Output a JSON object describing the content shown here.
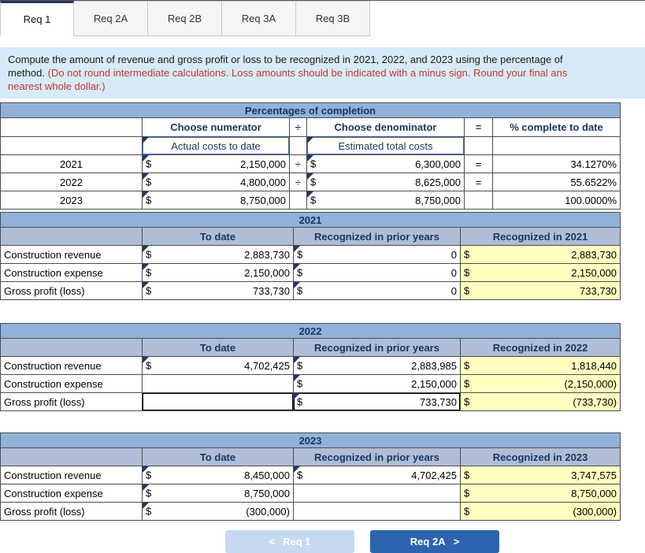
{
  "currency": "$",
  "colors": {
    "banner_blue": "#92b1d9",
    "subheader_blue": "#b0bdd7",
    "highlight_yellow": "#ffffc1",
    "instruction_bg": "#d7eaf7",
    "instruction_red": "#c0392b",
    "next_button_blue": "#2d64ad",
    "prev_button_blue": "#c7d9f1",
    "marker_navy": "#203864",
    "select_border_blue": "#4472c4"
  },
  "tabs": [
    {
      "label": "Req 1",
      "active": true
    },
    {
      "label": "Req 2A",
      "active": false
    },
    {
      "label": "Req 2B",
      "active": false
    },
    {
      "label": "Req 3A",
      "active": false
    },
    {
      "label": "Req 3B",
      "active": false
    }
  ],
  "instructions": {
    "line1_black": "Compute the amount of revenue and gross profit or loss to be recognized in 2021, 2022, and 2023 using the percentage of",
    "line2_black": "method.",
    "line2_red": "(Do not round intermediate calculations. Loss amounts should be indicated with a minus sign. Round your final ans",
    "line3_red": "nearest whole dollar.)"
  },
  "pct_table": {
    "title": "Percentages of completion",
    "headers": {
      "numerator": "Choose numerator",
      "divide": "÷",
      "denominator": "Choose denominator",
      "equals": "=",
      "pct": "% complete to date"
    },
    "selectors": {
      "numerator": "Actual costs to date",
      "denominator": "Estimated total costs"
    },
    "rows": [
      {
        "year": "2021",
        "numerator": "2,150,000",
        "divide": "÷",
        "denominator": "6,300,000",
        "equals": "=",
        "pct": "34.1270%"
      },
      {
        "year": "2022",
        "numerator": "4,800,000",
        "divide": "÷",
        "denominator": "8,625,000",
        "equals": "=",
        "pct": "55.6522%"
      },
      {
        "year": "2023",
        "numerator": "8,750,000",
        "divide": "",
        "denominator": "8,750,000",
        "equals": "",
        "pct": "100.0000%"
      }
    ]
  },
  "sections": [
    {
      "title": "2021",
      "headers": {
        "to_date": "To date",
        "prior": "Recognized in prior years",
        "recognized": "Recognized in 2021"
      },
      "rows": [
        {
          "label": "Construction revenue",
          "to_date": "2,883,730",
          "prior": "0",
          "recognized": "2,883,730"
        },
        {
          "label": "Construction expense",
          "to_date": "2,150,000",
          "prior": "0",
          "recognized": "2,150,000"
        },
        {
          "label": "Gross profit (loss)",
          "to_date": "733,730",
          "prior": "0",
          "recognized": "733,730"
        }
      ]
    },
    {
      "title": "2022",
      "headers": {
        "to_date": "To date",
        "prior": "Recognized in prior years",
        "recognized": "Recognized in 2022"
      },
      "rows": [
        {
          "label": "Construction revenue",
          "to_date": "4,702,425",
          "prior": "2,883,985",
          "recognized": "1,818,440"
        },
        {
          "label": "Construction expense",
          "to_date": "",
          "prior": "2,150,000",
          "recognized": "(2,150,000)"
        },
        {
          "label": "Gross profit (loss)",
          "to_date": "",
          "prior": "733,730",
          "recognized": "(733,730)"
        }
      ]
    },
    {
      "title": "2023",
      "headers": {
        "to_date": "To date",
        "prior": "Recognized in prior years",
        "recognized": "Recognized in 2023"
      },
      "rows": [
        {
          "label": "Construction revenue",
          "to_date": "8,450,000",
          "prior": "4,702,425",
          "recognized": "3,747,575"
        },
        {
          "label": "Construction expense",
          "to_date": "8,750,000",
          "prior": "",
          "recognized": "8,750,000"
        },
        {
          "label": "Gross profit (loss)",
          "to_date": "(300,000)",
          "prior": "",
          "recognized": "(300,000)"
        }
      ]
    }
  ],
  "footer": {
    "prev": {
      "chevron": "<",
      "label": "Req 1"
    },
    "next": {
      "label": "Req 2A",
      "chevron": ">"
    }
  }
}
